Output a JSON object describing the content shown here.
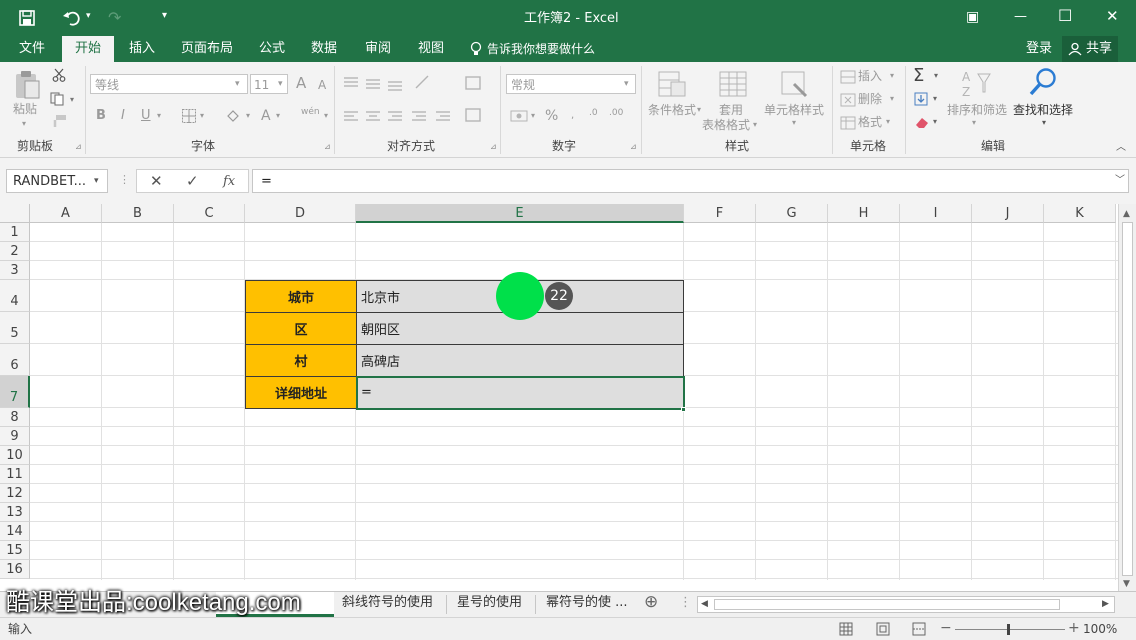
{
  "window": {
    "title": "工作簿2 - Excel",
    "redo_arrow": "↷",
    "customize_arrow": "▾",
    "restore_icon": "▣",
    "minimize_icon": "—",
    "maximize_icon": "☐",
    "close_icon": "✕"
  },
  "menu": {
    "tabs": [
      "文件",
      "开始",
      "插入",
      "页面布局",
      "公式",
      "数据",
      "审阅",
      "视图"
    ],
    "tell_me": "告诉我你想要做什么",
    "login": "登录",
    "share": "共享"
  },
  "ribbon": {
    "clipboard": {
      "paste": "粘贴",
      "group": "剪贴板"
    },
    "font": {
      "name": "等线",
      "size": "11",
      "grow": "A",
      "shrink": "A",
      "bold": "B",
      "italic": "I",
      "underline": "U",
      "font_color": "A",
      "phonetic": "wén",
      "group": "字体"
    },
    "alignment": {
      "group": "对齐方式"
    },
    "number": {
      "format": "常规",
      "percent": "%",
      "group": "数字"
    },
    "styles": {
      "conditional": "条件格式",
      "table_format_1": "套用",
      "table_format_2": "表格格式",
      "cell_styles": "单元格样式",
      "group": "样式"
    },
    "cells": {
      "insert": "插入",
      "delete": "删除",
      "format": "格式",
      "group": "单元格"
    },
    "editing": {
      "sort_filter": "排序和筛选",
      "find_select": "查找和选择",
      "group": "编辑",
      "sigma": "Σ"
    }
  },
  "formula_bar": {
    "name_box": "RANDBET...",
    "fx": "fx",
    "content": "="
  },
  "columns": [
    "A",
    "B",
    "C",
    "D",
    "E",
    "F",
    "G",
    "H",
    "I",
    "J",
    "K"
  ],
  "rows": [
    "1",
    "2",
    "3",
    "4",
    "5",
    "6",
    "7",
    "8",
    "9",
    "10",
    "11",
    "12",
    "13",
    "14",
    "15",
    "16"
  ],
  "table": {
    "rows": [
      {
        "label": "城市",
        "value": "北京市"
      },
      {
        "label": "区",
        "value": "朝阳区"
      },
      {
        "label": "村",
        "value": "高碑店"
      },
      {
        "label": "详细地址",
        "value": "="
      }
    ]
  },
  "overlay": {
    "click_count": "22"
  },
  "watermark": {
    "text": "酷课堂出品:coolketang.com"
  },
  "sheet_tabs": [
    "斜线符号的使用",
    "星号的使用",
    "幂符号的使 ..."
  ],
  "status": {
    "mode": "输入",
    "zoom": "100%"
  },
  "colors": {
    "excel_green": "#217346",
    "label_fill": "#ffc000",
    "value_fill": "#dedede",
    "cursor": "#00e04a"
  }
}
